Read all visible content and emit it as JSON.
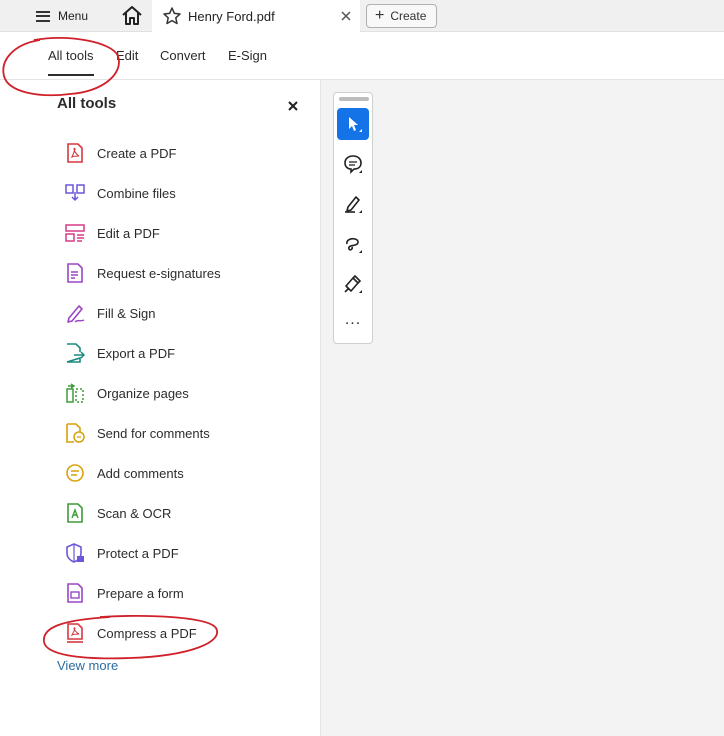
{
  "tabbar": {
    "menu_label": "Menu",
    "file_name": "Henry Ford.pdf",
    "create_label": "Create"
  },
  "toolbar": {
    "tabs": [
      {
        "label": "All tools",
        "active": true
      },
      {
        "label": "Edit",
        "active": false
      },
      {
        "label": "Convert",
        "active": false
      },
      {
        "label": "E-Sign",
        "active": false
      }
    ]
  },
  "panel": {
    "title": "All tools",
    "items": [
      {
        "label": "Create a PDF",
        "icon": "create-pdf-icon",
        "color": "#d7373f"
      },
      {
        "label": "Combine files",
        "icon": "combine-files-icon",
        "color": "#6e55d9"
      },
      {
        "label": "Edit a PDF",
        "icon": "edit-pdf-icon",
        "color": "#d53a8a"
      },
      {
        "label": "Request e-signatures",
        "icon": "request-esign-icon",
        "color": "#9b46c4"
      },
      {
        "label": "Fill & Sign",
        "icon": "fill-sign-icon",
        "color": "#9b46c4"
      },
      {
        "label": "Export a PDF",
        "icon": "export-pdf-icon",
        "color": "#1a8a7e"
      },
      {
        "label": "Organize pages",
        "icon": "organize-pages-icon",
        "color": "#3f9b3a"
      },
      {
        "label": "Send for comments",
        "icon": "send-comments-icon",
        "color": "#d9a20b"
      },
      {
        "label": "Add comments",
        "icon": "add-comments-icon",
        "color": "#d9a20b"
      },
      {
        "label": "Scan & OCR",
        "icon": "scan-ocr-icon",
        "color": "#3f9b3a"
      },
      {
        "label": "Protect a PDF",
        "icon": "protect-pdf-icon",
        "color": "#6e55d9"
      },
      {
        "label": "Prepare a form",
        "icon": "prepare-form-icon",
        "color": "#9b46c4"
      },
      {
        "label": "Compress a PDF",
        "icon": "compress-pdf-icon",
        "color": "#d7373f"
      }
    ],
    "view_more": "View more"
  },
  "quick_tools": {
    "more_label": "..."
  },
  "colors": {
    "accent": "#1473e6",
    "annotation": "#d0202a",
    "link": "#2d6ca2"
  }
}
